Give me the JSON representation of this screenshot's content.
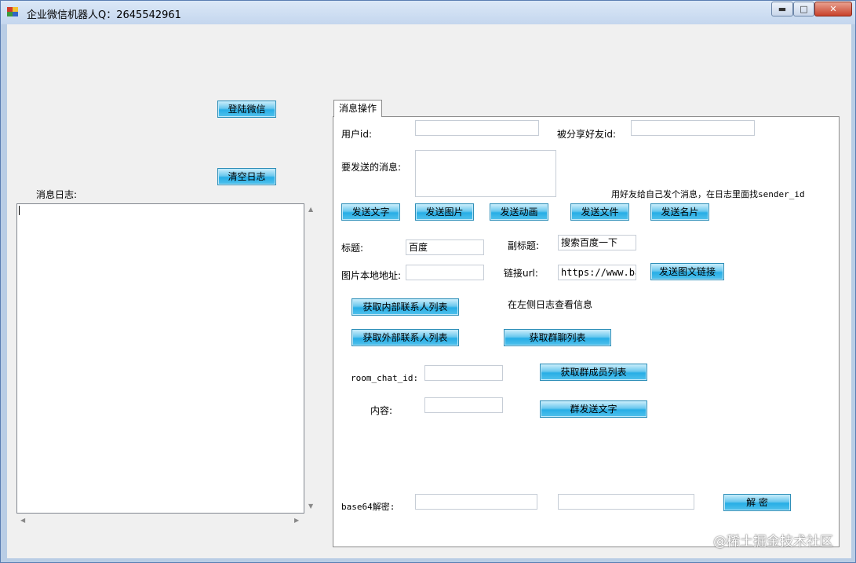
{
  "window": {
    "title": "企业微信机器人Q：2645542961",
    "min_glyph": "▬",
    "max_glyph": "□",
    "close_glyph": "✕"
  },
  "left": {
    "login_button": "登陆微信",
    "clear_log_button": "清空日志",
    "log_label": "消息日志:",
    "log_text": ""
  },
  "tab": {
    "title": "消息操作",
    "user_id_label": "用户id:",
    "user_id_value": "",
    "shared_friend_id_label": "被分享好友id:",
    "shared_friend_id_value": "",
    "message_label": "要发送的消息:",
    "message_value": "",
    "hint_sender": "用好友给自己发个消息，在日志里面找sender_id",
    "send_text_button": "发送文字",
    "send_image_button": "发送图片",
    "send_animation_button": "发送动画",
    "send_file_button": "发送文件",
    "send_card_button": "发送名片",
    "title_label": "标题:",
    "title_value": "百度",
    "subtitle_label": "副标题:",
    "subtitle_value": "搜索百度一下",
    "image_path_label": "图片本地地址:",
    "image_path_value": "",
    "link_url_label": "链接url:",
    "link_url_value": "https://www.baid",
    "send_link_button": "发送图文链接",
    "get_internal_contacts_button": "获取内部联系人列表",
    "hint_left_log": "在左侧日志查看信息",
    "get_external_contacts_button": "获取外部联系人列表",
    "get_group_list_button": "获取群聊列表",
    "room_chat_id_label": "room_chat_id:",
    "room_chat_id_value": "",
    "get_group_members_button": "获取群成员列表",
    "content_label": "内容:",
    "content_value": "",
    "group_send_text_button": "群发送文字",
    "base64_label": "base64解密:",
    "base64_input_value": "",
    "base64_output_value": "",
    "decrypt_button": "解 密"
  },
  "watermark": "@稀土掘金技术社区"
}
